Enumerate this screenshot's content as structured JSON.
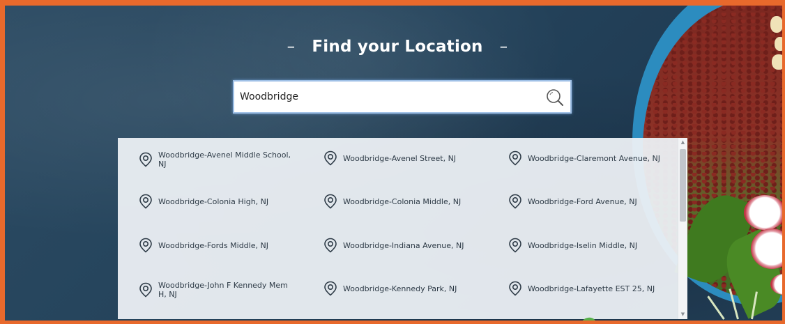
{
  "title": "Find your Location",
  "title_dash": "–",
  "search": {
    "value": "Woodbridge",
    "placeholder": ""
  },
  "results": [
    [
      "Woodbridge-Avenel Middle School, NJ",
      "Woodbridge-Avenel Street, NJ",
      "Woodbridge-Claremont Avenue, NJ"
    ],
    [
      "Woodbridge-Colonia High, NJ",
      "Woodbridge-Colonia Middle, NJ",
      "Woodbridge-Ford Avenue, NJ"
    ],
    [
      "Woodbridge-Fords Middle, NJ",
      "Woodbridge-Indiana Avenue, NJ",
      "Woodbridge-Iselin Middle, NJ"
    ],
    [
      "Woodbridge-John F Kennedy Mem H, NJ",
      "Woodbridge-Kennedy Park, NJ",
      "Woodbridge-Lafayette EST 25, NJ"
    ]
  ],
  "icons": {
    "search": "magnifier-icon",
    "result": "location-pin-icon"
  },
  "colors": {
    "frame": "#e8692c",
    "background": "#25445c",
    "accent": "#9fc0e6"
  }
}
